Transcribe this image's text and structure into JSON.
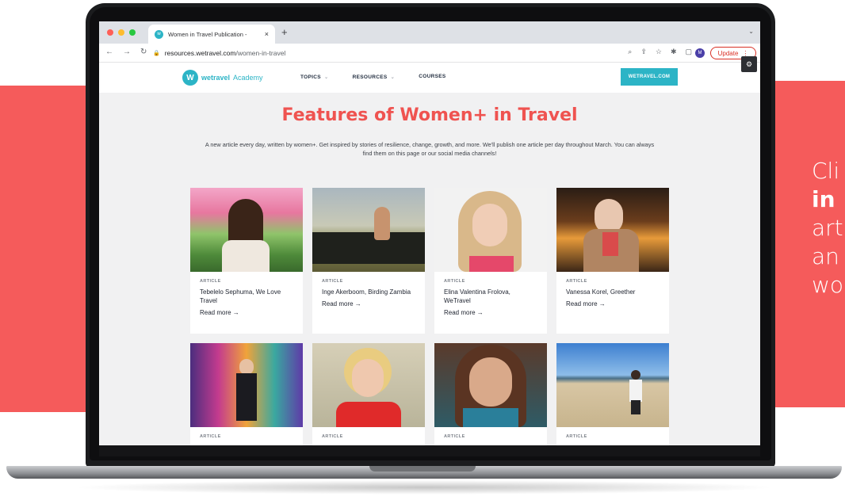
{
  "side_panel": {
    "line1": "Cli",
    "line2": "in ",
    "line3": "art",
    "line4": "an",
    "line5": "wo"
  },
  "browser": {
    "tab_title": "Women in Travel Publication -",
    "tab_close": "×",
    "new_tab": "+",
    "url_domain": "resources.wetravel.com",
    "url_path": "/women-in-travel",
    "profile_initial": "M",
    "update_label": "Update"
  },
  "site": {
    "logo_mark": "W",
    "logo_word": "wetravel",
    "logo_sub": "Academy",
    "menu": [
      {
        "label": "TOPICS",
        "has_dropdown": true
      },
      {
        "label": "RESOURCES",
        "has_dropdown": true
      },
      {
        "label": "COURSES",
        "has_dropdown": false
      }
    ],
    "cta_label": "WETRAVEL.COM"
  },
  "page": {
    "title": "Features of Women+ in Travel",
    "intro": "A new article every day, written by women+. Get inspired by stories of resilience, change, growth, and more. We'll publish one article per day throughout March. You can always find them on this page or our social media channels!"
  },
  "cards": [
    {
      "tag": "ARTICLE",
      "title": "Tebelelo Sephuma, We Love Travel",
      "read_more": "Read more →"
    },
    {
      "tag": "ARTICLE",
      "title": "Inge Akerboom, Birding Zambia",
      "read_more": "Read more →"
    },
    {
      "tag": "ARTICLE",
      "title": "Elina Valentina Frolova, WeTravel",
      "read_more": "Read more →"
    },
    {
      "tag": "ARTICLE",
      "title": "Vanessa Korel, Greether",
      "read_more": "Read more →"
    },
    {
      "tag": "ARTICLE"
    },
    {
      "tag": "ARTICLE"
    },
    {
      "tag": "ARTICLE"
    },
    {
      "tag": "ARTICLE"
    }
  ],
  "colors": {
    "brand_teal": "#2cb4c6",
    "accent_red": "#ef5350",
    "panel_red": "#f55b5b"
  }
}
